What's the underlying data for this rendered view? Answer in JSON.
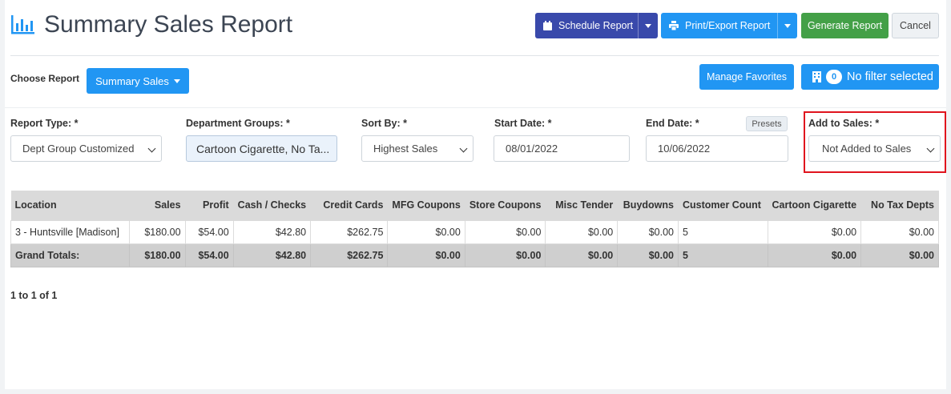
{
  "header": {
    "title": "Summary Sales Report",
    "schedule_label": "Schedule Report",
    "print_label": "Print/Export Report",
    "generate_label": "Generate Report",
    "cancel_label": "Cancel"
  },
  "toolbar": {
    "choose_label": "Choose Report",
    "report_button": "Summary Sales",
    "favorites_label": "Manage Favorites",
    "filter_count": "0",
    "filter_label": "No filter selected"
  },
  "filters": {
    "report_type_label": "Report Type: *",
    "report_type_value": "Dept Group Customized",
    "dept_groups_label": "Department Groups: *",
    "dept_groups_value": "Cartoon Cigarette, No Ta...",
    "sort_by_label": "Sort By: *",
    "sort_by_value": "Highest Sales",
    "start_date_label": "Start Date: *",
    "start_date_value": "08/01/2022",
    "end_date_label": "End Date: *",
    "end_date_value": "10/06/2022",
    "presets_label": "Presets",
    "add_to_sales_label": "Add to Sales: *",
    "add_to_sales_value": "Not Added to Sales"
  },
  "table": {
    "columns": [
      "Location",
      "Sales",
      "Profit",
      "Cash / Checks",
      "Credit Cards",
      "MFG Coupons",
      "Store Coupons",
      "Misc Tender",
      "Buydowns",
      "Customer Count",
      "Cartoon Cigarette",
      "No Tax Depts"
    ],
    "rows": [
      [
        "3 - Huntsville [Madison]",
        "$180.00",
        "$54.00",
        "$42.80",
        "$262.75",
        "$0.00",
        "$0.00",
        "$0.00",
        "$0.00",
        "5",
        "$0.00",
        "$0.00"
      ]
    ],
    "totals": [
      "Grand Totals:",
      "$180.00",
      "$54.00",
      "$42.80",
      "$262.75",
      "$0.00",
      "$0.00",
      "$0.00",
      "$0.00",
      "5",
      "$0.00",
      "$0.00"
    ]
  },
  "pager": {
    "text": "1 to 1 of 1"
  },
  "colors": {
    "primary": "#2196f3",
    "indigo": "#3949ab",
    "success": "#43a047",
    "highlight": "#e0141e"
  }
}
